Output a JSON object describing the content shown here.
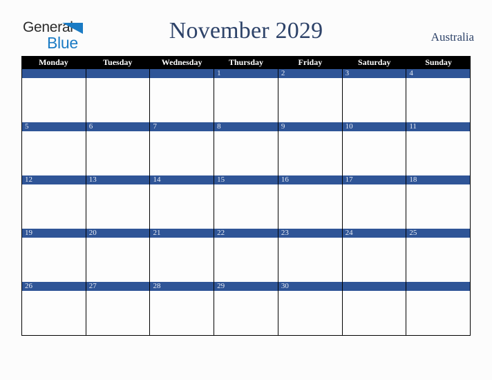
{
  "brand": {
    "name_part1": "General",
    "name_part2": "Blue",
    "triangle_icon": "triangle-icon",
    "primary_color": "#1a7bc4",
    "text_color": "#2b2b2b"
  },
  "header": {
    "title": "November 2029",
    "region": "Australia",
    "title_color": "#2e4369"
  },
  "calendar": {
    "month": "November",
    "year": "2029",
    "header_bg": "#000000",
    "header_text_color": "#ffffff",
    "day_bar_color": "#2f5597",
    "day_number_color": "#e8ecf5",
    "cell_bg": "#fdfdfd",
    "border_color": "#000000",
    "weekdays": [
      "Monday",
      "Tuesday",
      "Wednesday",
      "Thursday",
      "Friday",
      "Saturday",
      "Sunday"
    ],
    "weeks": [
      [
        "",
        "",
        "",
        "1",
        "2",
        "3",
        "4"
      ],
      [
        "5",
        "6",
        "7",
        "8",
        "9",
        "10",
        "11"
      ],
      [
        "12",
        "13",
        "14",
        "15",
        "16",
        "17",
        "18"
      ],
      [
        "19",
        "20",
        "21",
        "22",
        "23",
        "24",
        "25"
      ],
      [
        "26",
        "27",
        "28",
        "29",
        "30",
        "",
        ""
      ]
    ]
  }
}
